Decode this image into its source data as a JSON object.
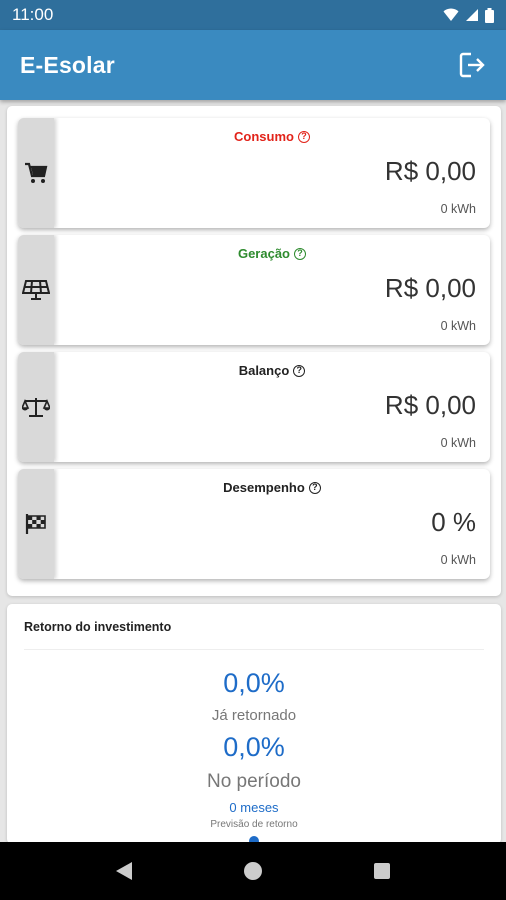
{
  "status_bar": {
    "time": "11:00"
  },
  "app_bar": {
    "title": "E-Esolar",
    "logout_icon": "logout-icon"
  },
  "colors": {
    "app_bar": "#3a8ac0",
    "status_bar": "#2f6f9c",
    "consumo_title": "#e2231a",
    "geracao_title": "#2e8b2e",
    "neutral_title": "#222222",
    "roi_accent": "#1e6cc8"
  },
  "cards": [
    {
      "title": "Consumo",
      "icon": "cart-icon",
      "value": "R$ 0,00",
      "sub": "0 kWh",
      "color": "#e2231a"
    },
    {
      "title": "Geração",
      "icon": "solar-panel-icon",
      "value": "R$ 0,00",
      "sub": "0 kWh",
      "color": "#2e8b2e"
    },
    {
      "title": "Balanço",
      "icon": "balance-scale-icon",
      "value": "R$ 0,00",
      "sub": "0 kWh",
      "color": "#222222"
    },
    {
      "title": "Desempenho",
      "icon": "checkered-flag-icon",
      "value": "0 %",
      "sub": "0 kWh",
      "color": "#222222"
    }
  ],
  "roi": {
    "title": "Retorno do investimento",
    "returned_value": "0,0%",
    "returned_label": "Já retornado",
    "period_value": "0,0%",
    "period_label": "No período",
    "months": "0 meses",
    "forecast_label": "Previsão de retorno"
  }
}
